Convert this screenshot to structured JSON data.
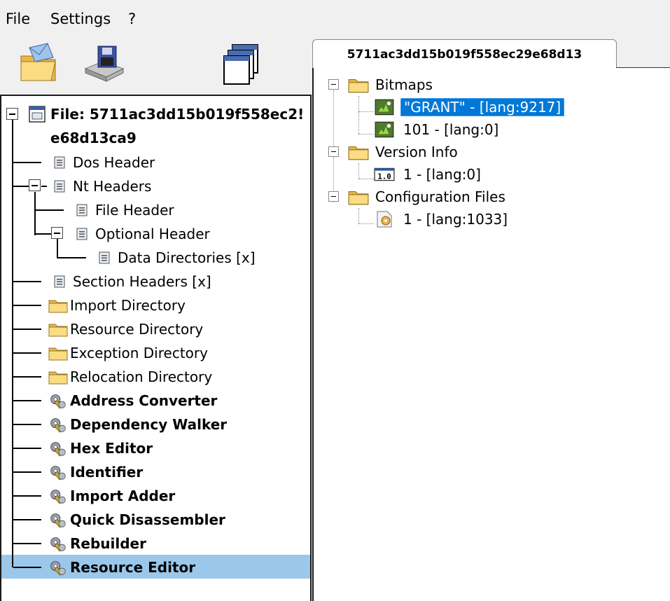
{
  "menu": [
    "File",
    "Settings",
    "?"
  ],
  "toolbar": {
    "open_icon": "open-folder-icon",
    "save_icon": "floppy-save-icon",
    "windows_icon": "windows-stack-icon"
  },
  "tree": {
    "root_label_line1": "File: 5711ac3dd15b019f558ec2!",
    "root_label_line2": "e68d13ca9",
    "items": [
      {
        "label": "Dos Header"
      },
      {
        "label": "Nt Headers"
      },
      {
        "label": "File Header"
      },
      {
        "label": "Optional Header"
      },
      {
        "label": "Data Directories [x]"
      },
      {
        "label": "Section Headers [x]"
      },
      {
        "label": "Import Directory"
      },
      {
        "label": "Resource Directory"
      },
      {
        "label": "Exception Directory"
      },
      {
        "label": "Relocation Directory"
      },
      {
        "label": "Address Converter"
      },
      {
        "label": "Dependency Walker"
      },
      {
        "label": "Hex Editor"
      },
      {
        "label": "Identifier"
      },
      {
        "label": "Import Adder"
      },
      {
        "label": "Quick Disassembler"
      },
      {
        "label": "Rebuilder"
      },
      {
        "label": "Resource Editor"
      }
    ]
  },
  "tab": {
    "label": "5711ac3dd15b019f558ec29e68d13"
  },
  "resources": {
    "bitmaps": "Bitmaps",
    "bitmap_items": [
      "\"GRANT\" - [lang:9217]",
      "101 - [lang:0]"
    ],
    "version_info": "Version Info",
    "version_items": [
      "1 - [lang:0]"
    ],
    "config_files": "Configuration Files",
    "config_items": [
      "1 - [lang:1033]"
    ]
  },
  "colors": {
    "selection_blue": "#0078d7",
    "tree_selection": "#9bc8ea"
  }
}
